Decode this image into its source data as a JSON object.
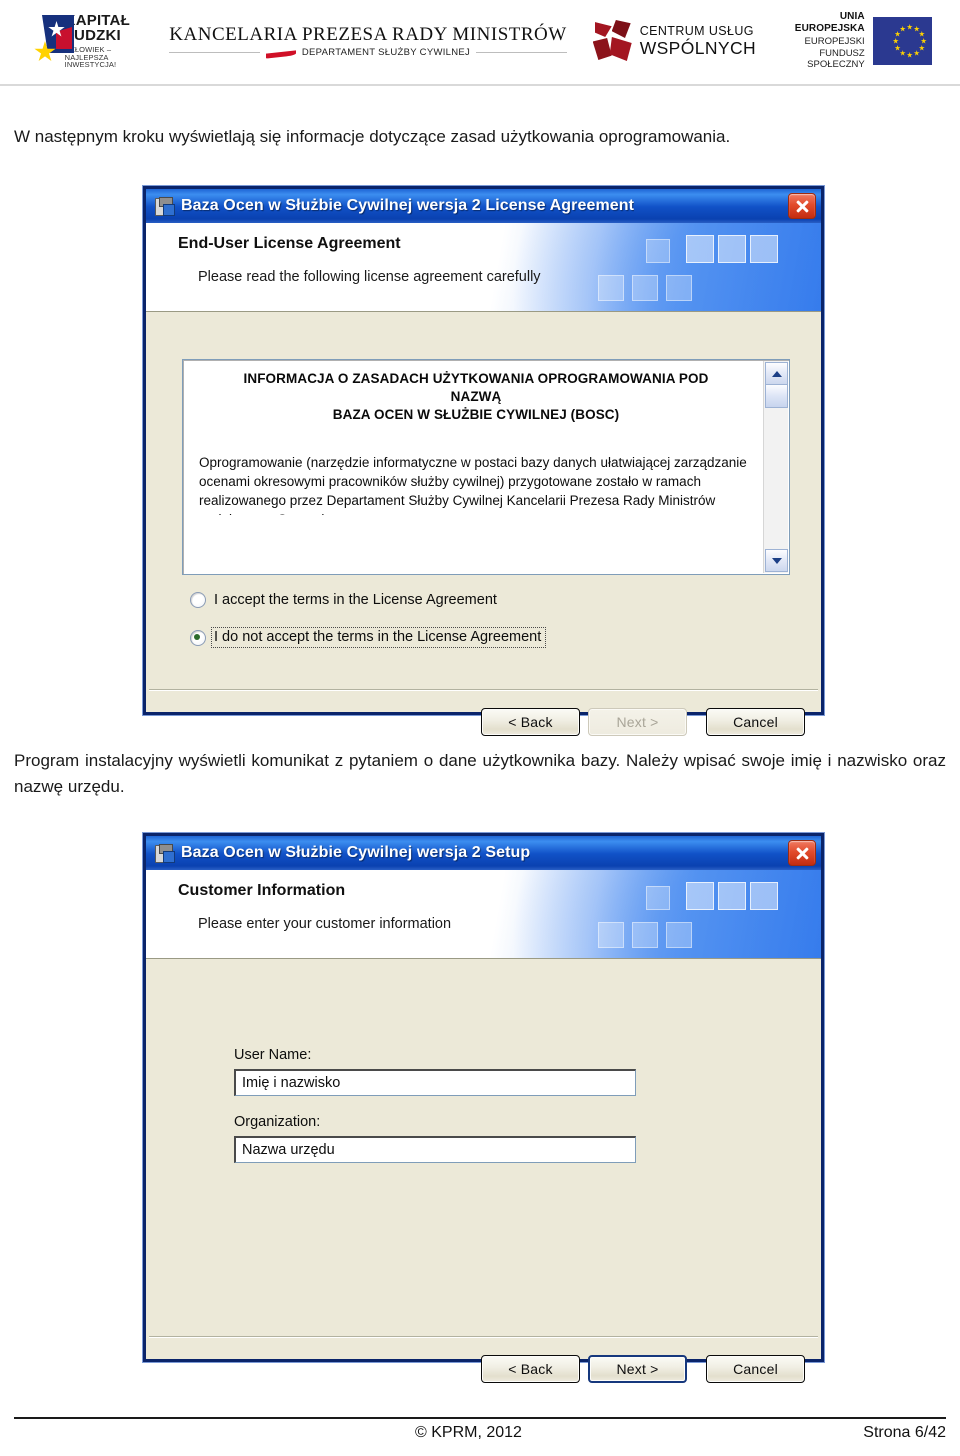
{
  "header": {
    "kapital_ludzki": {
      "line1": "KAPITAŁ LUDZKI",
      "line2": "CZŁOWIEK – NAJLEPSZA INWESTYCJA!"
    },
    "kprm": {
      "line1": "KANCELARIA PREZESA RADY MINISTRÓW",
      "line2": "DEPARTAMENT SŁUŻBY CYWILNEJ"
    },
    "cuw": {
      "line1": "CENTRUM USŁUG",
      "line2": "WSPÓLNYCH"
    },
    "ue": {
      "line1": "UNIA EUROPEJSKA",
      "line2": "EUROPEJSKI",
      "line3": "FUNDUSZ SPOŁECZNY"
    }
  },
  "document": {
    "paragraph1": "W następnym kroku wyświetlają się informacje dotyczące zasad użytkowania oprogramowania.",
    "paragraph2": "Program instalacyjny wyświetli komunikat z pytaniem o dane użytkownika bazy. Należy wpisać swoje imię i nazwisko oraz nazwę urzędu."
  },
  "dialog_license": {
    "title": "Baza Ocen w Służbie Cywilnej wersja 2 License Agreement",
    "banner_title": "End-User License Agreement",
    "banner_subtitle": "Please read the following license agreement carefully",
    "license_heading_line1": "INFORMACJA O ZASADACH UŻYTKOWANIA OPROGRAMOWANIA POD",
    "license_heading_line2": "NAZWĄ",
    "license_heading_line3": "BAZA OCEN W SŁUŻBIE CYWILNEJ (BOSC)",
    "license_body": "Oprogramowanie (narzędzie informatyczne w postaci bazy danych ułatwiającej zarządzanie ocenami okresowymi pracowników służby cywilnej) przygotowane zostało w ramach realizowanego przez Departament Służby Cywilnej Kancelarii Prezesa Rady Ministrów projektu pn. „Strategia",
    "radio_accept": "I accept the terms in the License Agreement",
    "radio_decline": "I do not accept the terms in the License Agreement",
    "selected_radio": "decline",
    "buttons": {
      "back": "< Back",
      "next": "Next >",
      "cancel": "Cancel",
      "next_state": "disabled"
    }
  },
  "dialog_customer": {
    "title": "Baza Ocen w Służbie Cywilnej wersja 2 Setup",
    "banner_title": "Customer Information",
    "banner_subtitle": "Please enter your customer information",
    "user_name_label": "User Name:",
    "user_name_value": "Imię i nazwisko",
    "organization_label": "Organization:",
    "organization_value": "Nazwa urzędu",
    "buttons": {
      "back": "< Back",
      "next": "Next >",
      "cancel": "Cancel",
      "next_state": "default"
    }
  },
  "footer": {
    "copyright": "© KPRM, 2012",
    "page": "Strona 6/42"
  },
  "colors": {
    "titlebar_blue": "#1152c8",
    "dialog_border": "#0a246a",
    "dialog_face": "#ece9d8",
    "close_red": "#c32c10",
    "eu_blue": "#2b3990",
    "accent_red": "#a31621"
  }
}
